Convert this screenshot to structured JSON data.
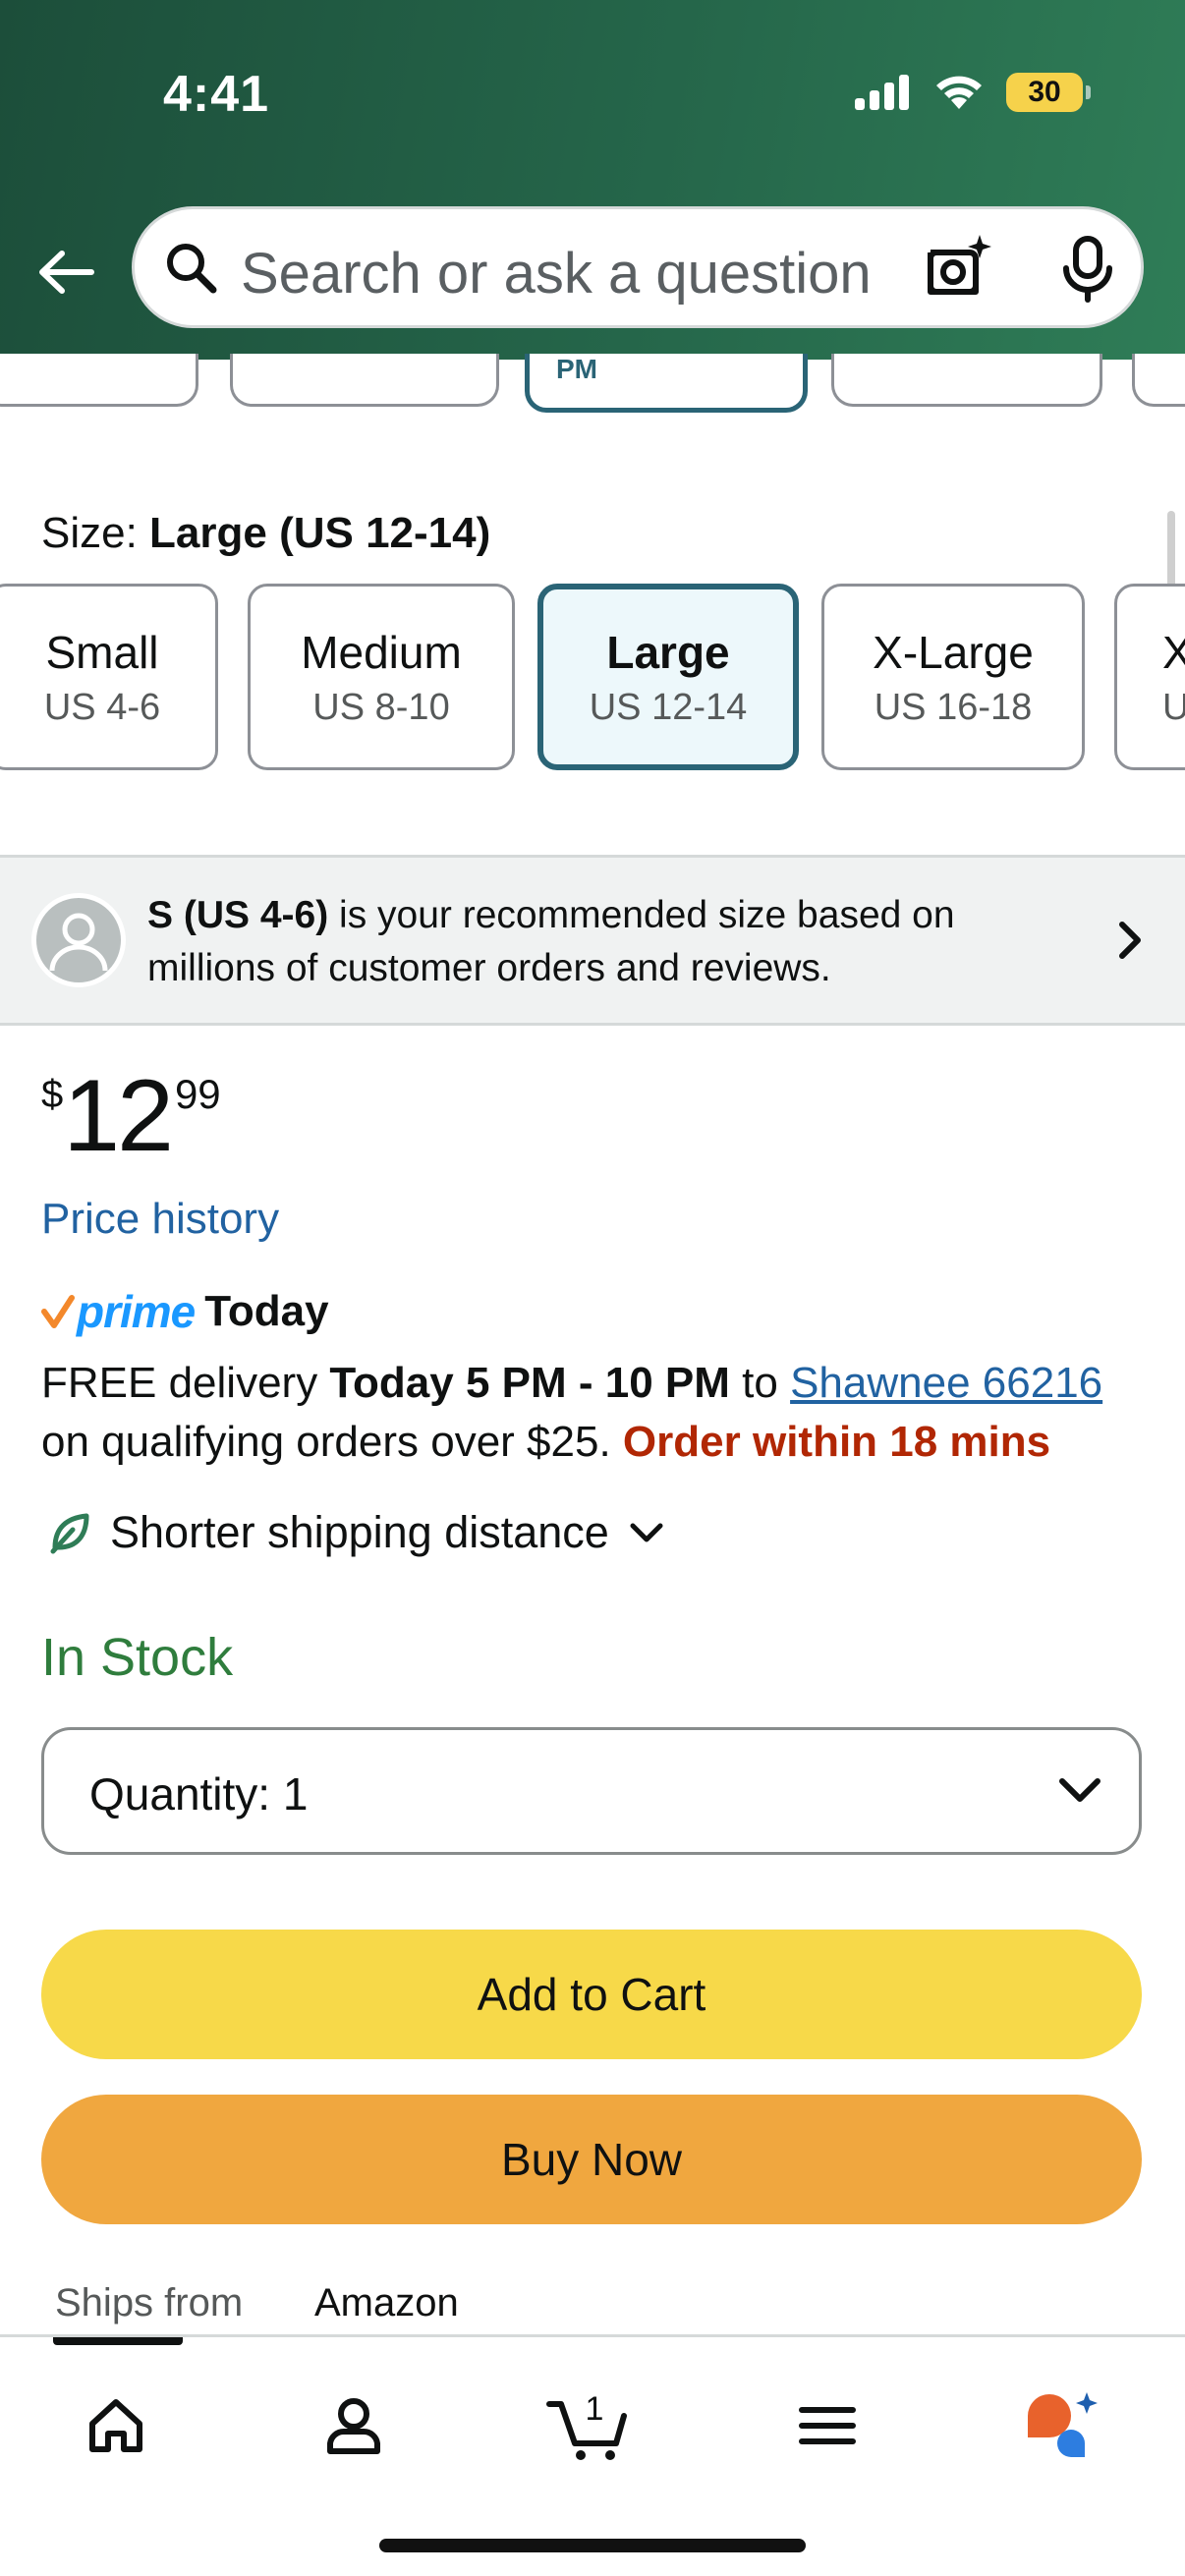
{
  "status_bar": {
    "time": "4:41",
    "battery": "30"
  },
  "search": {
    "placeholder": "Search or ask a question"
  },
  "variation_row": {
    "selected_partial_label": "PM"
  },
  "size": {
    "label_prefix": "Size: ",
    "selected_value": "Large (US 12-14)",
    "options": [
      {
        "name": "Small",
        "range": "US 4-6"
      },
      {
        "name": "Medium",
        "range": "US 8-10"
      },
      {
        "name": "Large",
        "range": "US 12-14"
      },
      {
        "name": "X-Large",
        "range": "US 16-18"
      },
      {
        "name": "X",
        "range": "U"
      }
    ]
  },
  "recommendation": {
    "size": "S (US 4-6)",
    "text": " is your recommended size based on millions of customer orders and reviews."
  },
  "price": {
    "symbol": "$",
    "whole": "12",
    "fraction": "99",
    "history_link": "Price history"
  },
  "prime": {
    "logo": "prime",
    "today_label": "Today",
    "delivery_prefix": "FREE delivery ",
    "delivery_window": "Today 5 PM - 10 PM",
    "delivery_to": " to ",
    "location": "Shawnee 66216",
    "qualifying": "on qualifying orders over $25. ",
    "urgency": "Order within 18 mins"
  },
  "shipping": {
    "label": "Shorter shipping distance"
  },
  "stock": {
    "status": "In Stock"
  },
  "quantity": {
    "label": "Quantity:",
    "value": "1"
  },
  "buttons": {
    "add_to_cart": "Add to Cart",
    "buy_now": "Buy Now"
  },
  "ships_from": {
    "label": "Ships from",
    "value": "Amazon"
  },
  "bottom_nav": {
    "cart_count": "1"
  },
  "colors": {
    "header_start": "#1c4e3a",
    "header_end": "#2f7d57",
    "selected_border": "#2a6476",
    "link": "#2162a1",
    "in_stock": "#2f7d3d",
    "urgent": "#b12704",
    "add_to_cart": "#f7d949",
    "buy_now": "#f0a73f"
  }
}
